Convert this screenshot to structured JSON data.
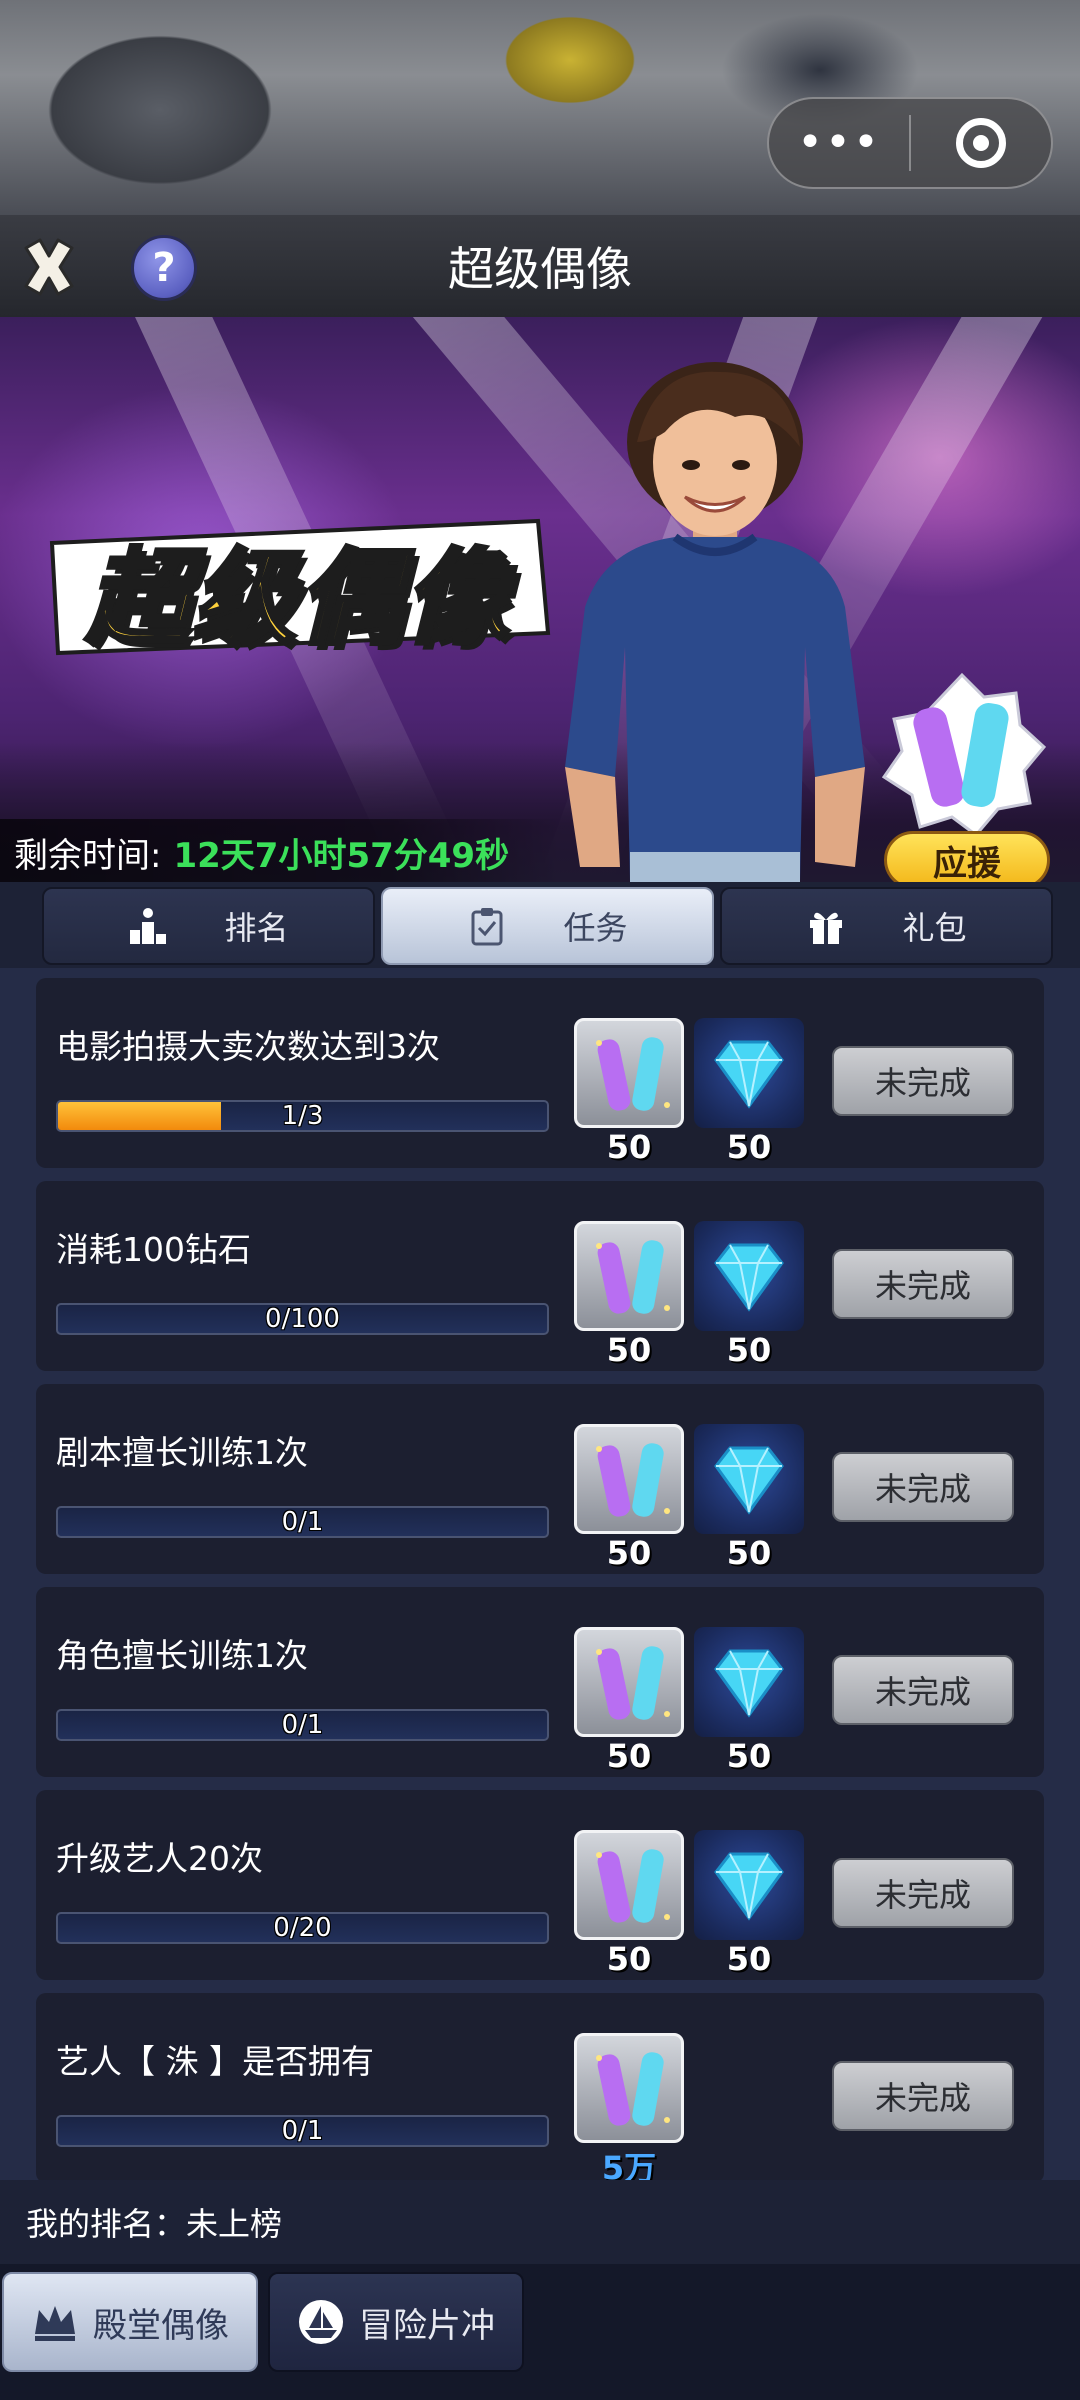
{
  "header": {
    "title": "超级偶像"
  },
  "banner": {
    "logo_text": "超级偶像",
    "timer_label": "剩余时间:",
    "timer_value": "12天7小时57分49秒",
    "support_label": "应援"
  },
  "tabs": [
    {
      "label": "排名",
      "icon": "podium-icon",
      "active": false
    },
    {
      "label": "任务",
      "icon": "clipboard-check-icon",
      "active": true
    },
    {
      "label": "礼包",
      "icon": "gift-icon",
      "active": false
    }
  ],
  "tasks": [
    {
      "title": "电影拍摄大卖次数达到3次",
      "progress_text": "1/3",
      "progress": 0.333,
      "rewards": [
        "50",
        "50"
      ],
      "status": "未完成"
    },
    {
      "title": "消耗100钻石",
      "progress_text": "0/100",
      "progress": 0,
      "rewards": [
        "50",
        "50"
      ],
      "status": "未完成"
    },
    {
      "title": "剧本擅长训练1次",
      "progress_text": "0/1",
      "progress": 0,
      "rewards": [
        "50",
        "50"
      ],
      "status": "未完成"
    },
    {
      "title": "角色擅长训练1次",
      "progress_text": "0/1",
      "progress": 0,
      "rewards": [
        "50",
        "50"
      ],
      "status": "未完成"
    },
    {
      "title": "升级艺人20次",
      "progress_text": "0/20",
      "progress": 0,
      "rewards": [
        "50",
        "50"
      ],
      "status": "未完成"
    },
    {
      "title": "艺人【 洙 】是否拥有",
      "progress_text": "0/1",
      "progress": 0,
      "rewards": [
        "5万"
      ],
      "status": "未完成"
    }
  ],
  "my_rank": {
    "text": "我的排名：未上榜"
  },
  "bottom_nav": [
    {
      "label": "殿堂偶像",
      "icon": "crown-icon",
      "active": true
    },
    {
      "label": "冒险片冲",
      "icon": "ship-icon",
      "active": false
    }
  ],
  "colors": {
    "timer_value": "#3be05a",
    "progress_fill": "#f28a0c",
    "logo_yellow": "#ffd23c",
    "support_button": "#f3b719",
    "reward_count_special": "#4aa8ff"
  }
}
